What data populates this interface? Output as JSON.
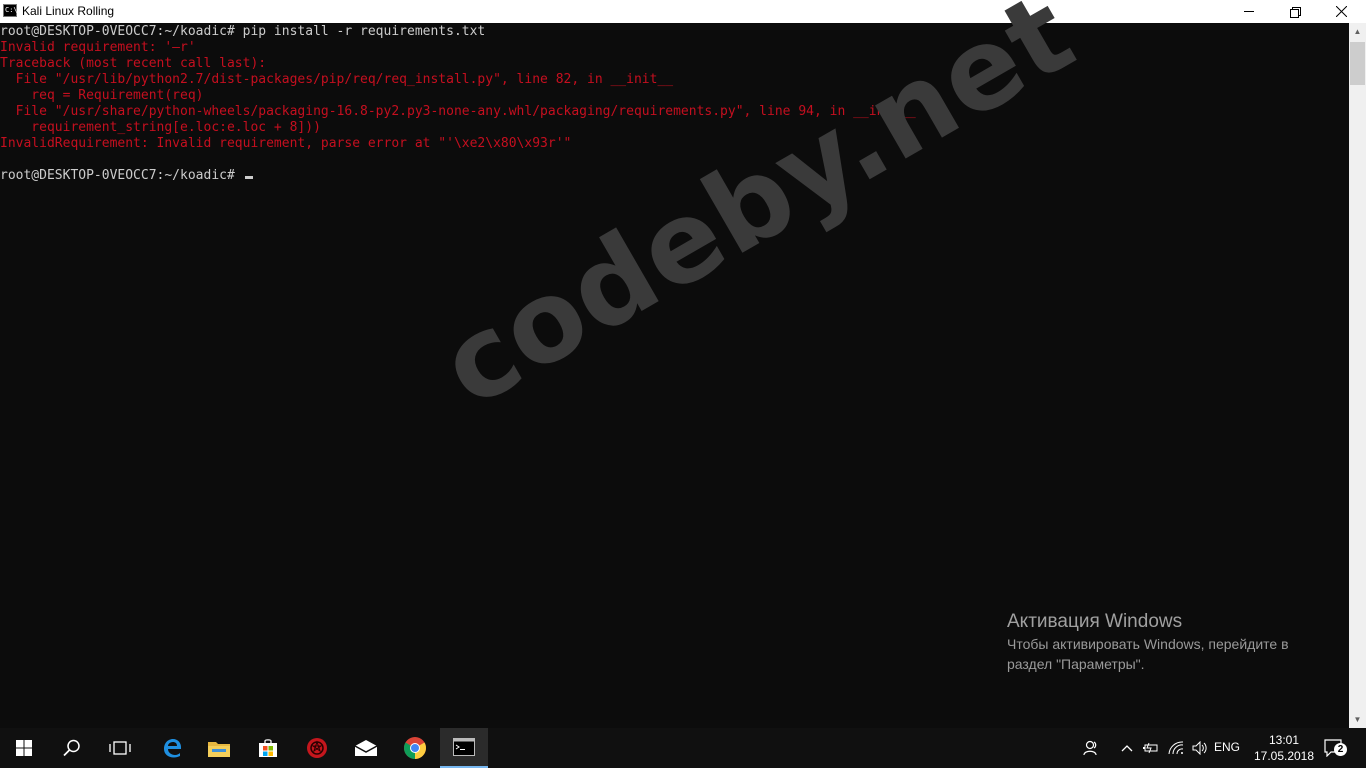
{
  "window": {
    "title": "Kali Linux Rolling",
    "icon_label": "C:\\."
  },
  "console": {
    "lines": [
      {
        "text": "root@DESKTOP-0VEOCC7:~/koadic# pip install -r requirements.txt",
        "color": "white"
      },
      {
        "text": "Invalid requirement: '–r'",
        "color": "red"
      },
      {
        "text": "Traceback (most recent call last):",
        "color": "red"
      },
      {
        "text": "  File \"/usr/lib/python2.7/dist-packages/pip/req/req_install.py\", line 82, in __init__",
        "color": "red"
      },
      {
        "text": "    req = Requirement(req)",
        "color": "red"
      },
      {
        "text": "  File \"/usr/share/python-wheels/packaging-16.8-py2.py3-none-any.whl/packaging/requirements.py\", line 94, in __init__",
        "color": "red"
      },
      {
        "text": "    requirement_string[e.loc:e.loc + 8]))",
        "color": "red"
      },
      {
        "text": "InvalidRequirement: Invalid requirement, parse error at \"'\\xe2\\x80\\x93r'\"",
        "color": "red"
      },
      {
        "text": "",
        "color": "white"
      },
      {
        "text": "root@DESKTOP-0VEOCC7:~/koadic# ",
        "color": "white"
      }
    ]
  },
  "watermark": "codeby.net",
  "activation": {
    "title": "Активация Windows",
    "text": "Чтобы активировать Windows, перейдите в раздел \"Параметры\"."
  },
  "taskbar": {
    "apps": [
      "start-icon",
      "search-icon",
      "task-view-icon",
      "edge-icon",
      "file-explorer-icon",
      "store-icon",
      "kali-icon",
      "mail-icon",
      "chrome-icon",
      "terminal-icon"
    ],
    "language": "ENG",
    "time": "13:01",
    "date": "17.05.2018",
    "notification_count": "2"
  },
  "colors": {
    "console_bg": "#0c0c0c",
    "console_text": "#cccccc",
    "error_text": "#c50f1f",
    "taskbar_bg": "#101010",
    "active_indicator": "#77b7f0"
  }
}
